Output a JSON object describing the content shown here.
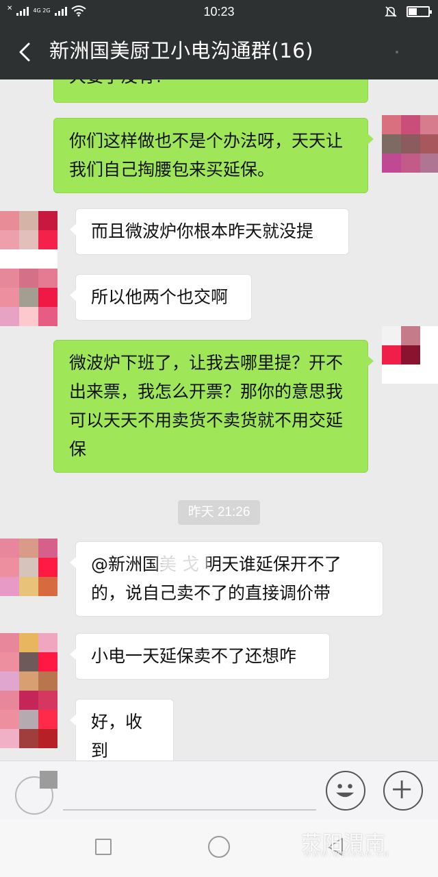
{
  "status_bar": {
    "network_label": "4G 2G",
    "time": "10:23"
  },
  "header": {
    "back_icon": "chevron-left-icon",
    "title": "新洲国美厨卫小电沟通群(16)"
  },
  "messages": [
    {
      "direction": "out",
      "text": "大姿了没有?"
    },
    {
      "direction": "out",
      "text": "你们这样做也不是个办法呀，天天让我们自己掏腰包来买延保。"
    },
    {
      "direction": "in",
      "text": "而且微波炉你根本昨天就没提"
    },
    {
      "direction": "in",
      "text": "所以他两个也交啊"
    },
    {
      "direction": "out",
      "text": "微波炉下班了，让我去哪里提？开不出来票，我怎么开票？那你的意思我可以天天不用卖货不卖货就不用交延保"
    },
    {
      "direction": "in",
      "text": "@新洲国美 戈  明天谁延保开不了的，说自己卖不了的直接调价带"
    },
    {
      "direction": "in",
      "text": "小电一天延保卖不了还想咋"
    },
    {
      "direction": "in",
      "text": "好，收到"
    }
  ],
  "timestamp": "昨天 21:26",
  "avatars": {
    "me_a": [
      "#d9707f",
      "#c94f7a",
      "#d67c8c",
      "#7c6a63",
      "#8c5b5e",
      "#a8585c",
      "#bf4a93",
      "#c25b88",
      "#b07592"
    ],
    "me_b": [
      "#f2f2f2",
      "#c57b8a",
      "#ffffff",
      "#ef1f4a",
      "#8a1330",
      "#ffffff",
      "#ffffff",
      "#ffffff",
      "#ffffff"
    ],
    "other_a": [
      "#e88d98",
      "#d3b4a6",
      "#c8183f",
      "#eba0ab",
      "#e3bfbb",
      "#f4224b",
      "#ffffff",
      "#ffffff",
      "#ffffff"
    ],
    "other_b": [
      "#e7879a",
      "#d47088",
      "#e57a93",
      "#ed8f9e",
      "#a39e92",
      "#f01946",
      "#e6a3c3",
      "#fcc9cf",
      "#e65c82"
    ],
    "other_c": [
      "#e8879b",
      "#d99b88",
      "#d7608a",
      "#ee8fa0",
      "#d5c4bb",
      "#ff1a44",
      "#e89ac6",
      "#e9c27a",
      "#d76a3e"
    ],
    "other_d": [
      "#e8879b",
      "#e7b65f",
      "#f1a6c0",
      "#ee8fa0",
      "#6e5a58",
      "#ff1844",
      "#e1a6cf",
      "#d6a072",
      "#b8754e"
    ],
    "other_e": [
      "#e8879b",
      "#c4265a",
      "#d6375e",
      "#ee8fa0",
      "#b5aab0",
      "#ff2a4a",
      "#f0b0c6",
      "#a03e3e",
      "#b82028"
    ]
  },
  "input_bar": {
    "voice_icon": "voice-icon",
    "emoji_icon": "smiley-icon",
    "more_icon": "plus-icon"
  },
  "nav_bar": {
    "recent_icon": "square-icon",
    "home_icon": "circle-icon",
    "back_icon": "triangle-back-icon",
    "watermark": "荥阳渭南",
    "watermark_sub": "WWW.WEINAN.CN"
  },
  "colors": {
    "header_bg": "#2e3132",
    "chat_bg": "#ebebeb",
    "out_bubble": "#9fe658",
    "in_bubble": "#ffffff"
  }
}
